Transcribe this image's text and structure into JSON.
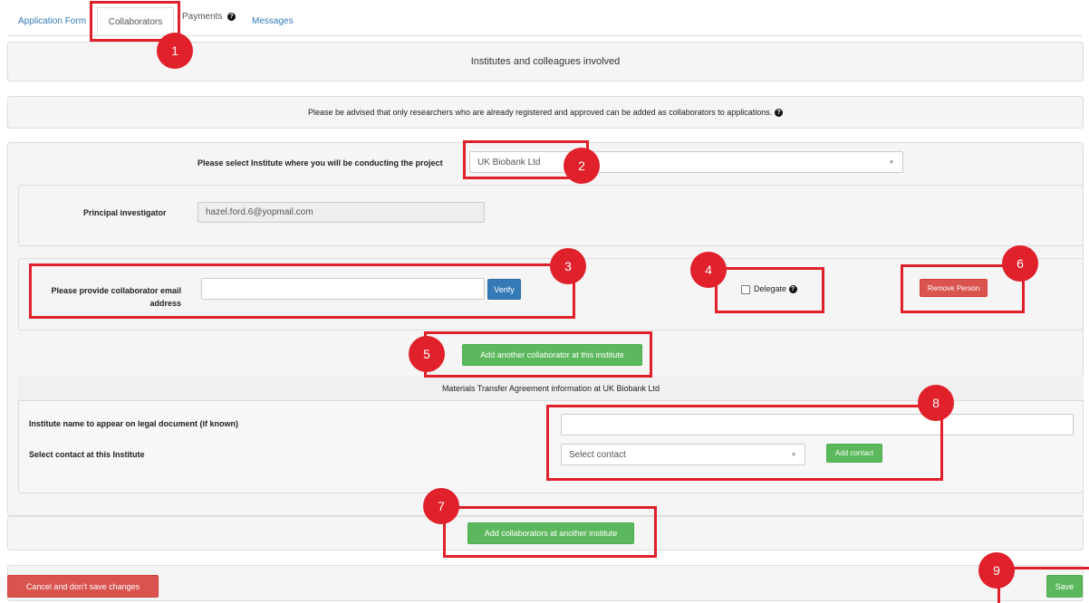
{
  "tabs": {
    "application_form": "Application Form",
    "collaborators": "Collaborators",
    "payments": "Payments",
    "messages": "Messages"
  },
  "section_title": "Institutes and colleagues involved",
  "advisory": "Please be advised that only researchers who are already registered and approved can be added as collaborators to applications.",
  "institute": {
    "label": "Please select Institute where you will be conducting the project",
    "selected": "UK Biobank Ltd"
  },
  "pi": {
    "label": "Principal investigator",
    "value": "hazel.ford.6@yopmail.com"
  },
  "collaborator": {
    "label_line1": "Please provide collaborator email",
    "label_line2": "address",
    "value": "",
    "verify": "Verify",
    "delegate": "Delegate",
    "remove": "Remove Person"
  },
  "add_another": "Add another collaborator at this institute",
  "mta": {
    "title": "Materials Transfer Agreement information at UK Biobank Ltd",
    "institute_name_label": "Institute name to appear on legal document (if known)",
    "institute_name_value": "",
    "contact_label": "Select contact at this Institute",
    "contact_placeholder": "Select contact",
    "add_contact": "Add contact"
  },
  "add_institute": "Add collaborators at another institute",
  "footer": {
    "cancel": "Cancel and don't save changes",
    "save": "Save"
  },
  "markers": [
    "1",
    "2",
    "3",
    "4",
    "5",
    "6",
    "7",
    "8",
    "9"
  ],
  "colors": {
    "highlight": "#e0202a",
    "primary": "#337ab7",
    "success": "#5cb85c",
    "danger": "#d9534f"
  }
}
